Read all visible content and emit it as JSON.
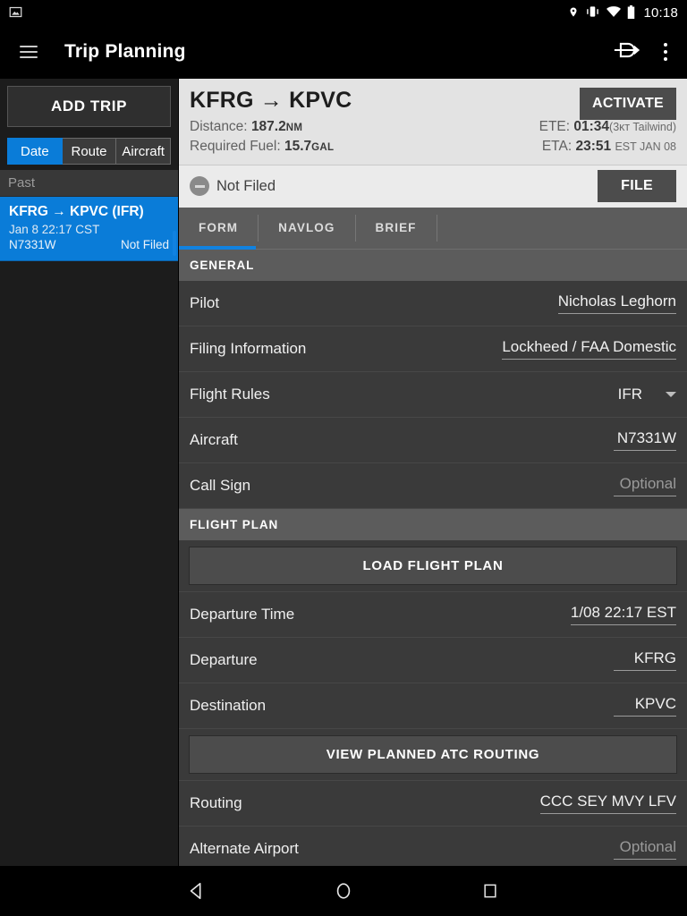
{
  "statusbar": {
    "photo_icon": "image-icon",
    "icons": [
      "location-icon",
      "vibrate-icon",
      "wifi-icon",
      "battery-icon"
    ],
    "time": "10:18"
  },
  "appbar": {
    "menu_icon": "hamburger-menu-icon",
    "title": "Trip Planning",
    "direct_to_icon": "direct-to-icon",
    "overflow_icon": "overflow-menu-icon"
  },
  "sidebar": {
    "add_trip_label": "ADD TRIP",
    "filters": [
      {
        "label": "Date",
        "active": true
      },
      {
        "label": "Route",
        "active": false
      },
      {
        "label": "Aircraft",
        "active": false
      }
    ],
    "group_header": "Past",
    "trips": [
      {
        "title": "KFRG → KPVC (IFR)",
        "datetime": "Jan 8 22:17 CST",
        "tail": "N7331W",
        "status": "Not Filed"
      }
    ]
  },
  "summary": {
    "route": "KFRG → KPVC",
    "distance_label": "Distance:",
    "distance_value": "187.2",
    "distance_unit": "NM",
    "fuel_label": "Required Fuel:",
    "fuel_value": "15.7",
    "fuel_unit": "GAL",
    "ete_label": "ETE:",
    "ete_value": "01:34",
    "ete_note": "(3ᴋᴛ Tailwind)",
    "eta_label": "ETA:",
    "eta_value": "23:51",
    "eta_note": "EST JAN 08",
    "activate_label": "ACTIVATE"
  },
  "filebar": {
    "status_icon": "minus-circle-icon",
    "status_text": "Not Filed",
    "file_label": "FILE"
  },
  "tabs": [
    {
      "label": "FORM",
      "active": true
    },
    {
      "label": "NAVLOG",
      "active": false
    },
    {
      "label": "BRIEF",
      "active": false
    }
  ],
  "sections": [
    {
      "header": "GENERAL",
      "rows": [
        {
          "type": "field",
          "label": "Pilot",
          "value": "Nicholas Leghorn",
          "placeholder": false
        },
        {
          "type": "field",
          "label": "Filing Information",
          "value": "Lockheed / FAA Domestic",
          "placeholder": false
        },
        {
          "type": "select",
          "label": "Flight Rules",
          "value": "IFR",
          "caret_icon": "chevron-down-icon"
        },
        {
          "type": "field",
          "label": "Aircraft",
          "value": "N7331W",
          "placeholder": false
        },
        {
          "type": "field",
          "label": "Call Sign",
          "value": "Optional",
          "placeholder": true
        }
      ]
    },
    {
      "header": "FLIGHT PLAN",
      "rows": [
        {
          "type": "button",
          "label": "LOAD FLIGHT PLAN"
        },
        {
          "type": "field",
          "label": "Departure Time",
          "value": "1/08 22:17 EST",
          "placeholder": false
        },
        {
          "type": "field",
          "label": "Departure",
          "value": "KFRG",
          "placeholder": false
        },
        {
          "type": "field",
          "label": "Destination",
          "value": "KPVC",
          "placeholder": false
        },
        {
          "type": "button",
          "label": "VIEW PLANNED ATC ROUTING"
        },
        {
          "type": "field",
          "label": "Routing",
          "value": "CCC SEY MVY LFV",
          "placeholder": false
        },
        {
          "type": "field",
          "label": "Alternate Airport",
          "value": "Optional",
          "placeholder": true
        }
      ]
    }
  ],
  "navbar": {
    "back_icon": "back-triangle-icon",
    "home_icon": "home-circle-icon",
    "recents_icon": "recents-square-icon"
  },
  "colors": {
    "accent": "#0a7cd8",
    "appbar_bg": "#000000",
    "sidebar_bg": "#1c1c1c",
    "form_bg": "#3a3a3a",
    "section_hdr_bg": "#5c5c5c",
    "summary_bg": "#e3e3e3"
  }
}
